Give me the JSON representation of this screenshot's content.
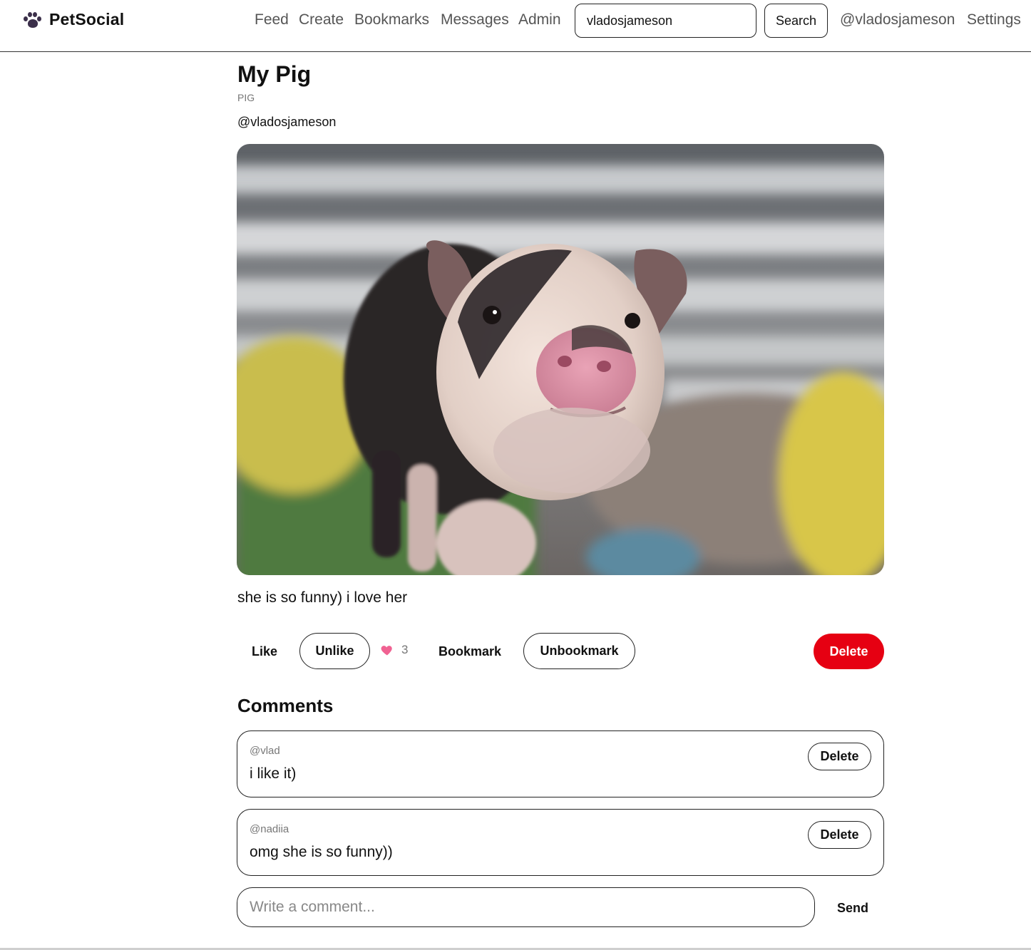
{
  "app": {
    "name": "PetSocial",
    "logo_icon": "paw-icon"
  },
  "nav": {
    "feed": "Feed",
    "create": "Create",
    "bookmarks": "Bookmarks",
    "messages": "Messages",
    "admin": "Admin",
    "search_value": "vladosjameson",
    "search_button": "Search",
    "profile": "@vladosjameson",
    "settings": "Settings"
  },
  "post": {
    "title": "My Pig",
    "type": "PIG",
    "author": "@vladosjameson",
    "caption": "she is so funny) i love her",
    "image_subject": "pig-photo"
  },
  "actions": {
    "like": "Like",
    "unlike": "Unlike",
    "likes_count": "3",
    "likes_icon": "heart-icon",
    "bookmark": "Bookmark",
    "unbookmark": "Unbookmark",
    "delete": "Delete",
    "colors": {
      "danger": "#e60012",
      "heart": "#f06292"
    }
  },
  "comments": {
    "title": "Comments",
    "items": [
      {
        "author": "@vlad",
        "text": "i like it)",
        "delete": "Delete"
      },
      {
        "author": "@nadiia",
        "text": "omg she is so funny))",
        "delete": "Delete"
      }
    ],
    "input_placeholder": "Write a comment...",
    "send": "Send"
  }
}
